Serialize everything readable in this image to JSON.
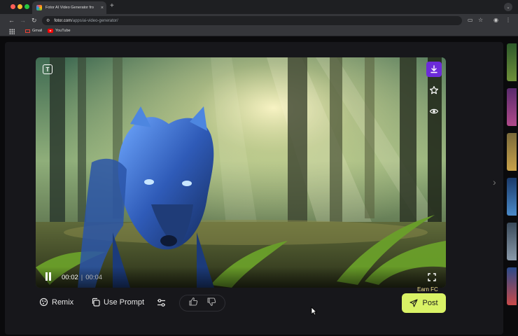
{
  "browser": {
    "tab_title": "Fotor AI Video Generator fro",
    "new_tab_symbol": "+",
    "tab_close_symbol": "×",
    "url_host": "fotor.com",
    "url_path": "/apps/ai-video-generator/",
    "bookmarks": [
      {
        "label": "Gmail",
        "icon": "gmail-icon"
      },
      {
        "label": "YouTube",
        "icon": "youtube-icon"
      }
    ]
  },
  "player": {
    "current_time": "00:02",
    "separator": "|",
    "duration": "00:04",
    "progress": 0.5,
    "text_badge": "T",
    "side_actions": [
      "download-icon",
      "star-icon",
      "eye-icon"
    ],
    "state": "playing"
  },
  "actions": {
    "remix_label": "Remix",
    "use_prompt_label": "Use Prompt",
    "earn_label": "Earn FC",
    "post_label": "Post"
  },
  "colors": {
    "accent_purple": "#6c2bd9",
    "post_button": "#d9f266",
    "earn_text": "#f0e08a",
    "panel": "#17171b"
  }
}
